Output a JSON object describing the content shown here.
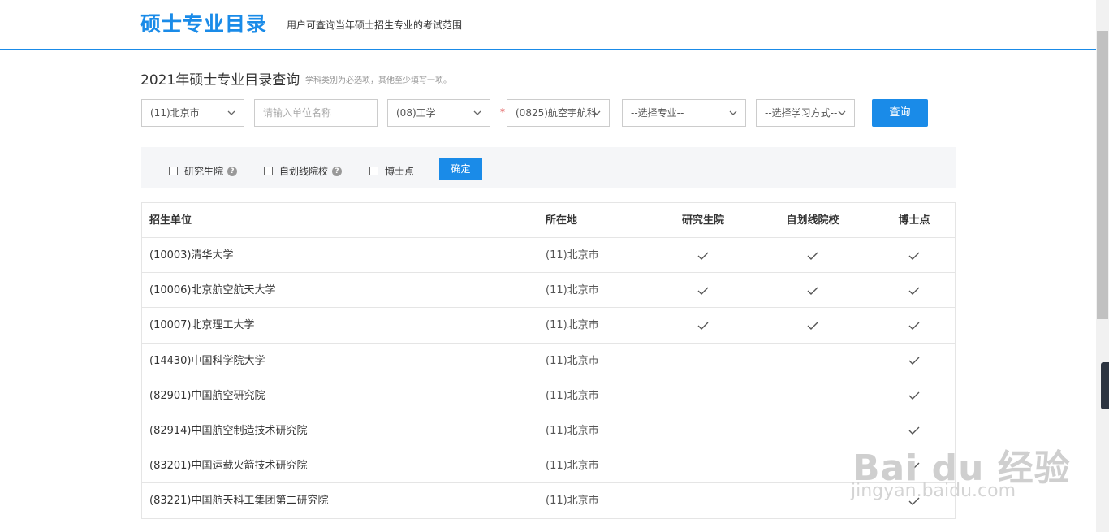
{
  "header": {
    "brand": "硕士专业目录",
    "subtitle": "用户可查询当年硕士招生专业的考试范围"
  },
  "query": {
    "title": "2021年硕士专业目录查询",
    "hint": "学科类别为必选项，其他至少填写一项。",
    "province_select": "(11)北京市",
    "unit_placeholder": "请输入单位名称",
    "category_select": "(08)工学",
    "required_mark": "*",
    "discipline_select": "(0825)航空宇航科",
    "major_select": "--选择专业--",
    "mode_select": "--选择学习方式--",
    "submit_label": "查询"
  },
  "filters": {
    "graduate_school": "研究生院",
    "self_line": "自划线院校",
    "phd_point": "博士点",
    "help_glyph": "?",
    "ok_label": "确定"
  },
  "table": {
    "headers": [
      "招生单位",
      "所在地",
      "研究生院",
      "自划线院校",
      "博士点"
    ],
    "rows": [
      {
        "name": "(10003)清华大学",
        "location": "(11)北京市",
        "graduate_school": true,
        "self_line": true,
        "phd": true
      },
      {
        "name": "(10006)北京航空航天大学",
        "location": "(11)北京市",
        "graduate_school": true,
        "self_line": true,
        "phd": true
      },
      {
        "name": "(10007)北京理工大学",
        "location": "(11)北京市",
        "graduate_school": true,
        "self_line": true,
        "phd": true
      },
      {
        "name": "(14430)中国科学院大学",
        "location": "(11)北京市",
        "graduate_school": false,
        "self_line": false,
        "phd": true
      },
      {
        "name": "(82901)中国航空研究院",
        "location": "(11)北京市",
        "graduate_school": false,
        "self_line": false,
        "phd": true
      },
      {
        "name": "(82914)中国航空制造技术研究院",
        "location": "(11)北京市",
        "graduate_school": false,
        "self_line": false,
        "phd": true
      },
      {
        "name": "(83201)中国运载火箭技术研究院",
        "location": "(11)北京市",
        "graduate_school": false,
        "self_line": false,
        "phd": true
      },
      {
        "name": "(83221)中国航天科工集团第二研究院",
        "location": "(11)北京市",
        "graduate_school": false,
        "self_line": false,
        "phd": true
      }
    ]
  },
  "watermark": {
    "line1": "Bai du 经验",
    "line2": "jingyan.baidu.com"
  },
  "colors": {
    "accent": "#1a8be8",
    "required": "#e05555"
  }
}
